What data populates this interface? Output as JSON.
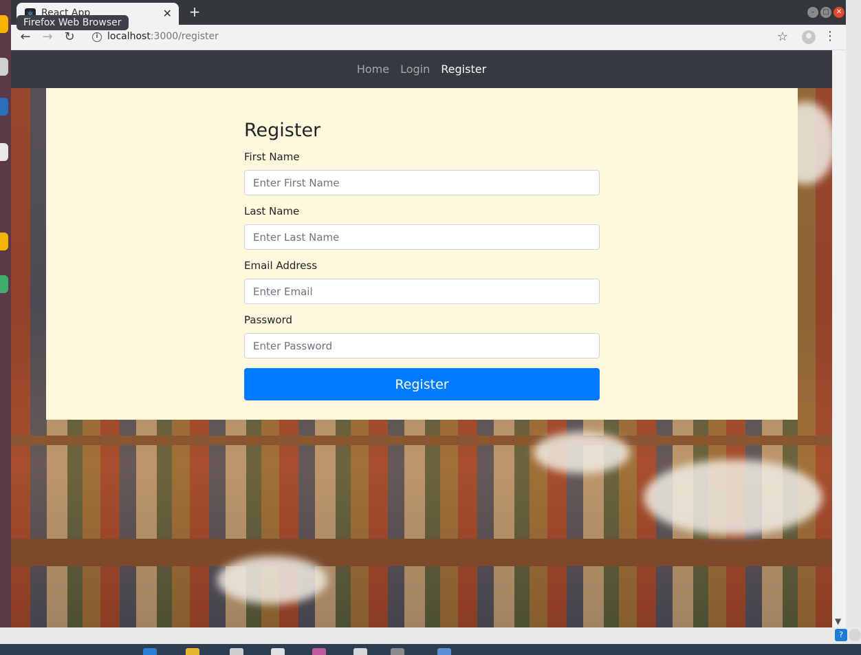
{
  "browser": {
    "tab_title": "React App",
    "tooltip": "Firefox Web Browser",
    "new_tab": "+",
    "url_host": "localhost",
    "url_path": ":3000/register"
  },
  "navbar": {
    "links": [
      {
        "label": "Home",
        "active": false
      },
      {
        "label": "Login",
        "active": false
      },
      {
        "label": "Register",
        "active": true
      }
    ]
  },
  "form": {
    "title": "Register",
    "fields": [
      {
        "label": "First Name",
        "placeholder": "Enter First Name"
      },
      {
        "label": "Last Name",
        "placeholder": "Enter Last Name"
      },
      {
        "label": "Email Address",
        "placeholder": "Enter Email"
      },
      {
        "label": "Password",
        "placeholder": "Enter Password"
      }
    ],
    "submit_label": "Register"
  },
  "colors": {
    "navbar_bg": "#343a40",
    "card_bg": "#fff8dc",
    "primary": "#007bff"
  }
}
